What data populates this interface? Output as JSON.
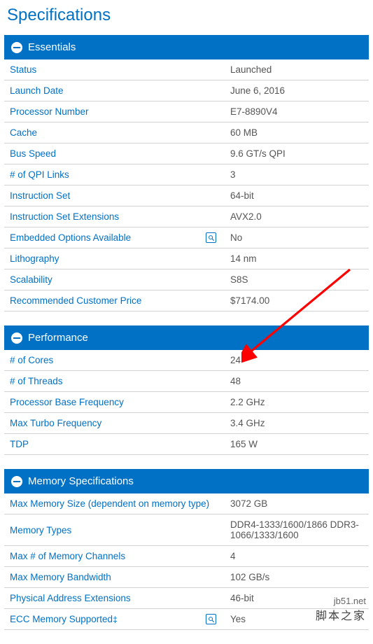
{
  "page_title": "Specifications",
  "sections": {
    "essentials": {
      "title": "Essentials",
      "rows": [
        {
          "label": "Status",
          "value": "Launched",
          "info": false
        },
        {
          "label": "Launch Date",
          "value": "June 6, 2016",
          "info": false
        },
        {
          "label": "Processor Number",
          "value": "E7-8890V4",
          "info": false
        },
        {
          "label": "Cache",
          "value": "60 MB",
          "info": false
        },
        {
          "label": "Bus Speed",
          "value": "9.6 GT/s QPI",
          "info": false
        },
        {
          "label": "# of QPI Links",
          "value": "3",
          "info": false
        },
        {
          "label": "Instruction Set",
          "value": "64-bit",
          "info": false
        },
        {
          "label": "Instruction Set Extensions",
          "value": "AVX2.0",
          "info": false
        },
        {
          "label": "Embedded Options Available",
          "value": "No",
          "info": true
        },
        {
          "label": "Lithography",
          "value": "14 nm",
          "info": false
        },
        {
          "label": "Scalability",
          "value": "S8S",
          "info": false
        },
        {
          "label": "Recommended Customer Price",
          "value": "$7174.00",
          "info": false
        }
      ]
    },
    "performance": {
      "title": "Performance",
      "rows": [
        {
          "label": "# of Cores",
          "value": "24",
          "info": false
        },
        {
          "label": "# of Threads",
          "value": "48",
          "info": false
        },
        {
          "label": "Processor Base Frequency",
          "value": "2.2 GHz",
          "info": false
        },
        {
          "label": "Max Turbo Frequency",
          "value": "3.4 GHz",
          "info": false
        },
        {
          "label": "TDP",
          "value": "165 W",
          "info": false
        }
      ]
    },
    "memory": {
      "title": "Memory Specifications",
      "rows": [
        {
          "label": "Max Memory Size (dependent on memory type)",
          "value": "3072 GB",
          "info": false
        },
        {
          "label": "Memory Types",
          "value": "DDR4-1333/1600/1866 DDR3-1066/1333/1600",
          "info": false
        },
        {
          "label": "Max # of Memory Channels",
          "value": "4",
          "info": false
        },
        {
          "label": "Max Memory Bandwidth",
          "value": "102 GB/s",
          "info": false
        },
        {
          "label": "Physical Address Extensions",
          "value": "46-bit",
          "info": false
        },
        {
          "label": "ECC Memory Supported",
          "value": "Yes",
          "info": true,
          "ddag": true
        }
      ]
    }
  },
  "watermark": {
    "line1": "jb51.net",
    "line2": "脚本之家"
  },
  "colors": {
    "accent": "#0071c5"
  }
}
